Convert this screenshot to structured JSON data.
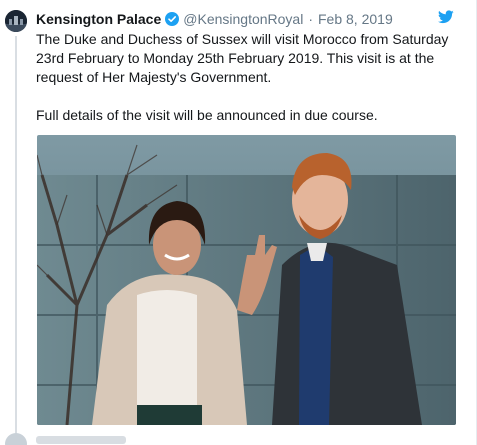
{
  "tweet": {
    "author_name": "Kensington Palace",
    "handle": "@KensingtonRoyal",
    "separator": "·",
    "date": "Feb 8, 2019",
    "text_line1": "The Duke and Duchess of Sussex will visit Morocco from Saturday 23rd February to Monday 25th February 2019. This visit is at the request of Her Majesty's Government.",
    "text_line2": "Full details of the visit will be announced in due course."
  },
  "icons": {
    "verified": "verified-badge-icon",
    "brand": "twitter-bird-icon"
  },
  "colors": {
    "brand_blue": "#1da1f2",
    "text_primary": "#14171a",
    "text_secondary": "#657786"
  }
}
